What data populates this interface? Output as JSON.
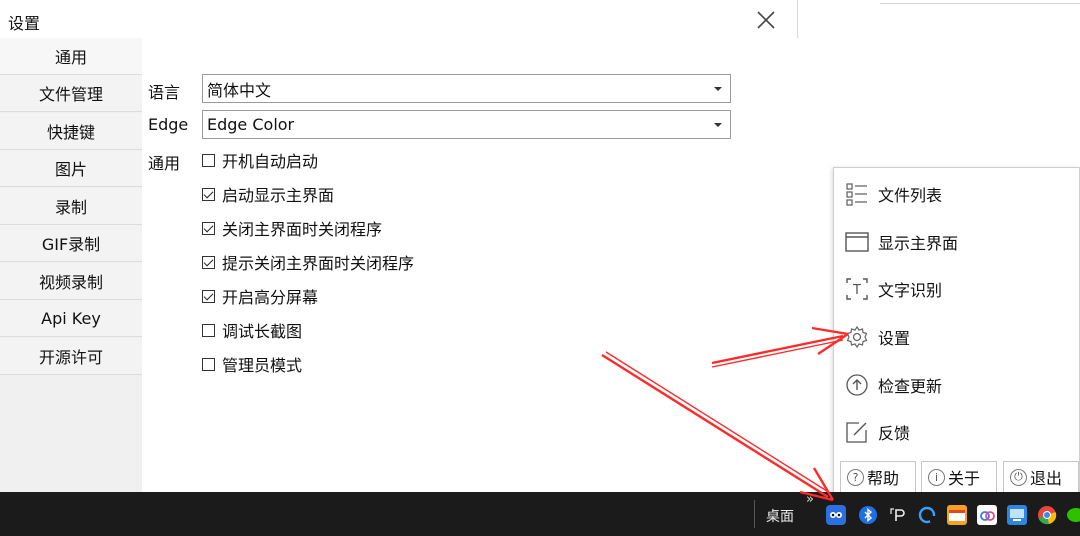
{
  "window": {
    "title": "设置",
    "sidebar": [
      {
        "label": "通用"
      },
      {
        "label": "文件管理"
      },
      {
        "label": "快捷键"
      },
      {
        "label": "图片"
      },
      {
        "label": "录制"
      },
      {
        "label": "GIF录制"
      },
      {
        "label": "视频录制"
      },
      {
        "label": "Api Key"
      },
      {
        "label": "开源许可"
      }
    ],
    "language": {
      "label": "语言",
      "value": "简体中文"
    },
    "edge": {
      "label": "Edge",
      "value": "Edge Color"
    },
    "general": {
      "label": "通用",
      "options": [
        {
          "label": "开机自动启动",
          "checked": false
        },
        {
          "label": "启动显示主界面",
          "checked": true
        },
        {
          "label": "关闭主界面时关闭程序",
          "checked": true
        },
        {
          "label": "提示关闭主界面时关闭程序",
          "checked": true
        },
        {
          "label": "开启高分屏幕",
          "checked": true
        },
        {
          "label": "调试长截图",
          "checked": false
        },
        {
          "label": "管理员模式",
          "checked": false
        }
      ]
    }
  },
  "tray_menu": {
    "items": [
      {
        "label": "文件列表",
        "icon": "file-list-icon"
      },
      {
        "label": "显示主界面",
        "icon": "window-icon"
      },
      {
        "label": "文字识别",
        "icon": "text-recognition-icon"
      },
      {
        "label": "设置",
        "icon": "gear-icon"
      },
      {
        "label": "检查更新",
        "icon": "update-arrow-icon"
      },
      {
        "label": "反馈",
        "icon": "edit-icon"
      }
    ],
    "buttons": [
      {
        "label": "帮助",
        "icon": "question-icon",
        "glyph": "?"
      },
      {
        "label": "关于",
        "icon": "info-icon",
        "glyph": "i"
      },
      {
        "label": "退出",
        "icon": "power-icon",
        "glyph": "⏻"
      }
    ]
  },
  "taskbar": {
    "overflow": "»",
    "desktop_label": "桌面"
  },
  "colors": {
    "arrow": "#ff2a2a",
    "taskbar": "#1b1b1b"
  }
}
